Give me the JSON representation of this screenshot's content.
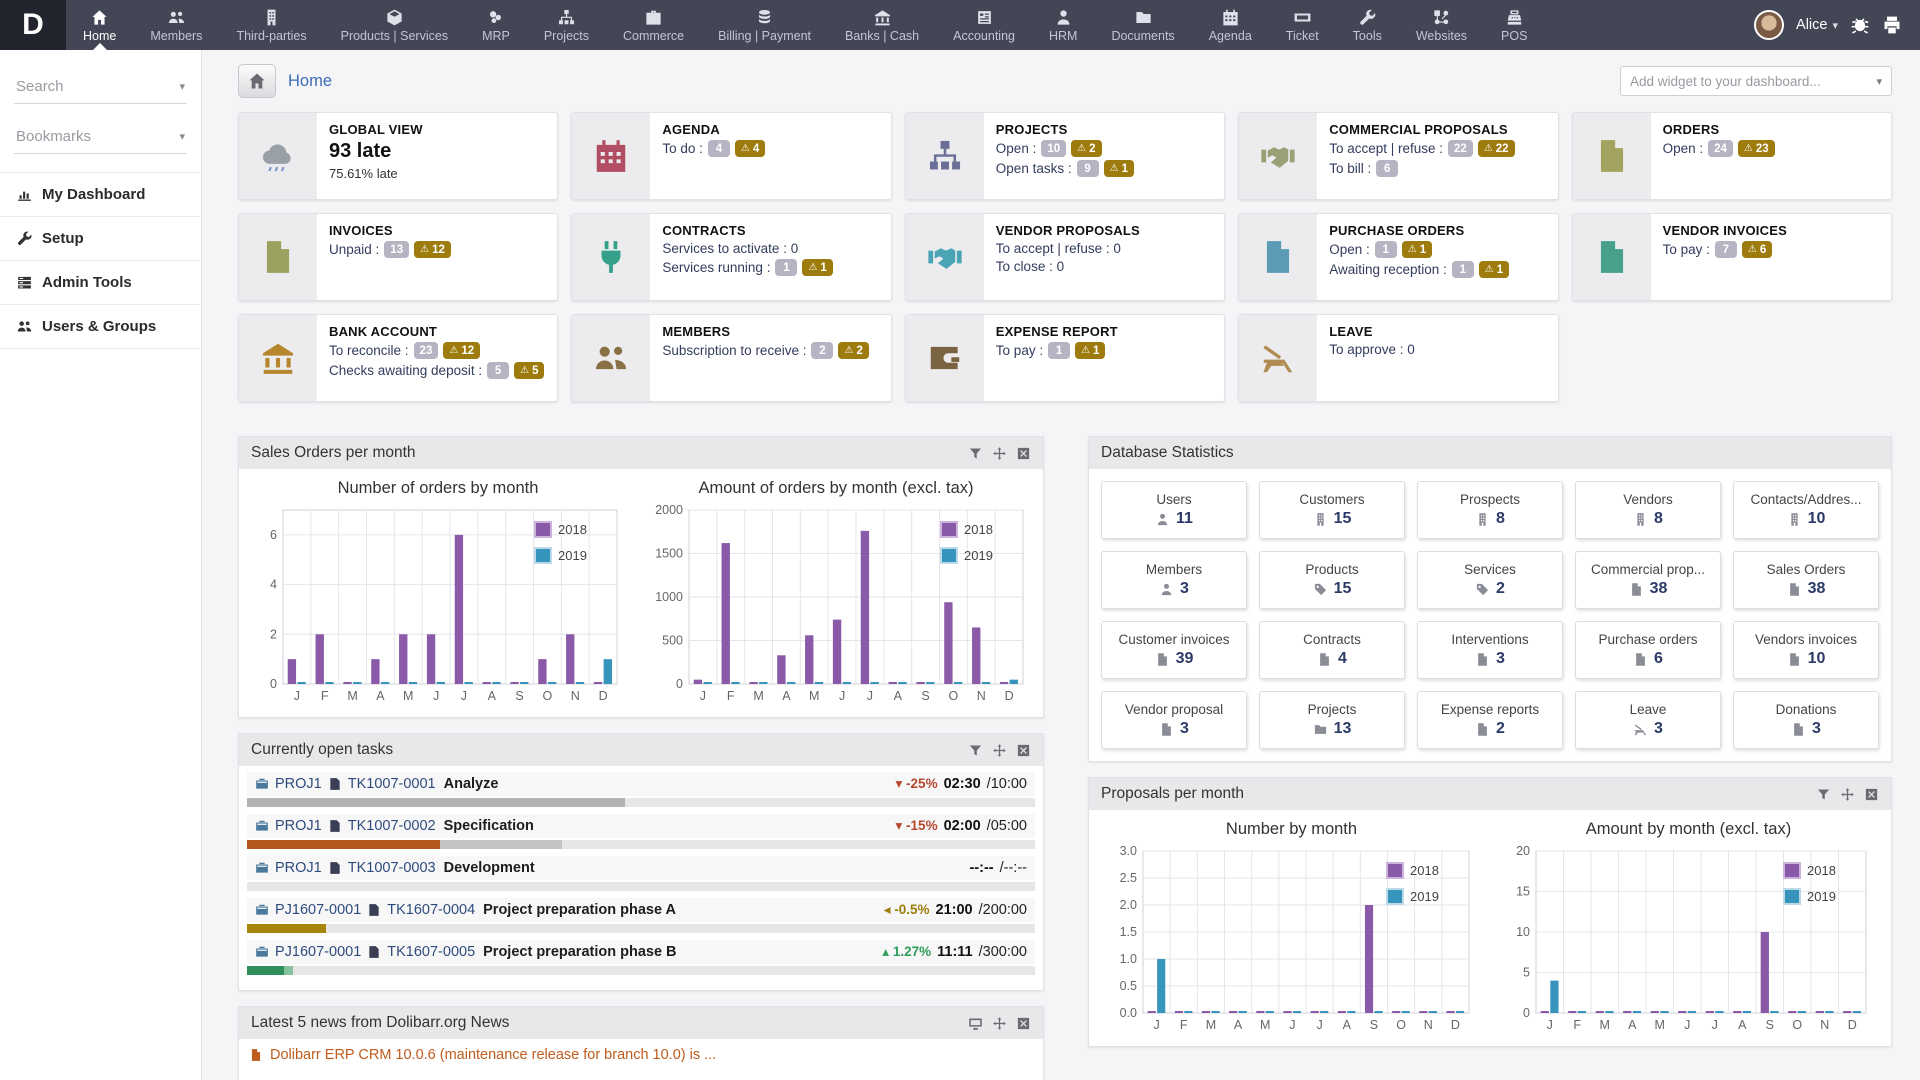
{
  "colors": {
    "navbar_bg": "#424655",
    "logo_bg": "#23252e",
    "accent_link": "#3b6db4",
    "badge_count": "#b7b3c2",
    "badge_warn": "#9d7b0c",
    "bar_2018": "#8a5aa8",
    "bar_2019": "#3795bd"
  },
  "navbar": {
    "logo": "D",
    "items": [
      {
        "label": "Home",
        "icon": "home-icon",
        "active": true
      },
      {
        "label": "Members",
        "icon": "members-icon"
      },
      {
        "label": "Third-parties",
        "icon": "building-icon"
      },
      {
        "label": "Products | Services",
        "icon": "cube-icon"
      },
      {
        "label": "MRP",
        "icon": "mrp-icon"
      },
      {
        "label": "Projects",
        "icon": "sitemap-icon"
      },
      {
        "label": "Commerce",
        "icon": "briefcase-icon"
      },
      {
        "label": "Billing | Payment",
        "icon": "coins-icon"
      },
      {
        "label": "Banks | Cash",
        "icon": "bank-icon"
      },
      {
        "label": "Accounting",
        "icon": "calculator-icon"
      },
      {
        "label": "HRM",
        "icon": "person-icon"
      },
      {
        "label": "Documents",
        "icon": "folder-icon"
      },
      {
        "label": "Agenda",
        "icon": "calendar-icon"
      },
      {
        "label": "Ticket",
        "icon": "ticket-icon"
      },
      {
        "label": "Tools",
        "icon": "wrench-icon"
      },
      {
        "label": "Websites",
        "icon": "nodes-icon"
      },
      {
        "label": "POS",
        "icon": "register-icon"
      }
    ],
    "user": {
      "name": "Alice"
    }
  },
  "sidebar": {
    "search_label": "Search",
    "bookmarks_label": "Bookmarks",
    "items": [
      {
        "label": "My Dashboard",
        "icon": "chartbar-icon"
      },
      {
        "label": "Setup",
        "icon": "wrench-icon"
      },
      {
        "label": "Admin Tools",
        "icon": "server-icon"
      },
      {
        "label": "Users & Groups",
        "icon": "members-icon"
      }
    ]
  },
  "breadcrumb": {
    "title": "Home"
  },
  "add_widget_placeholder": "Add widget to your dashboard...",
  "kpi_boxes": [
    {
      "title": "GLOBAL VIEW",
      "icon": "cloud-icon",
      "color": "#9aa0a8",
      "lines": [
        {
          "text": "93 late",
          "style": "big"
        },
        {
          "text": "75.61% late",
          "style": "small"
        }
      ]
    },
    {
      "title": "AGENDA",
      "icon": "calendar-icon",
      "color": "#b24e63",
      "lines": [
        {
          "text": "To do :",
          "count": "4",
          "warn": "4"
        }
      ]
    },
    {
      "title": "PROJECTS",
      "icon": "sitemap-icon",
      "color": "#6b6e96",
      "lines": [
        {
          "text": "Open :",
          "count": "10",
          "warn": "2"
        },
        {
          "text": "Open tasks :",
          "count": "9",
          "warn": "1"
        }
      ]
    },
    {
      "title": "COMMERCIAL PROPOSALS",
      "icon": "handshake-icon",
      "color": "#9aa076",
      "lines": [
        {
          "text": "To accept | refuse :",
          "count": "22",
          "warn": "22"
        },
        {
          "text": "To bill :",
          "count": "6"
        }
      ]
    },
    {
      "title": "ORDERS",
      "icon": "doc-icon",
      "color": "#a3a35f",
      "lines": [
        {
          "text": "Open :",
          "count": "24",
          "warn": "23"
        }
      ]
    },
    {
      "title": "INVOICES",
      "icon": "doc-icon",
      "color": "#9aa05e",
      "lines": [
        {
          "text": "Unpaid :",
          "count": "13",
          "warn": "12"
        }
      ]
    },
    {
      "title": "CONTRACTS",
      "icon": "plug-icon",
      "color": "#35a08a",
      "lines": [
        {
          "text": "Services to activate : 0"
        },
        {
          "text": "Services running :",
          "count": "1",
          "warn": "1"
        }
      ]
    },
    {
      "title": "VENDOR PROPOSALS",
      "icon": "handshake-icon",
      "color": "#4aa4b5",
      "lines": [
        {
          "text": "To accept | refuse : 0"
        },
        {
          "text": "To close : 0"
        }
      ]
    },
    {
      "title": "PURCHASE ORDERS",
      "icon": "doc-icon",
      "color": "#5b9bb5",
      "lines": [
        {
          "text": "Open :",
          "count": "1",
          "warn": "1"
        },
        {
          "text": "Awaiting reception :",
          "count": "1",
          "warn": "1"
        }
      ]
    },
    {
      "title": "VENDOR INVOICES",
      "icon": "doc-icon",
      "color": "#46a08c",
      "lines": [
        {
          "text": "To pay :",
          "count": "7",
          "warn": "6"
        }
      ]
    },
    {
      "title": "BANK ACCOUNT",
      "icon": "bank-icon",
      "color": "#b5862b",
      "lines": [
        {
          "text": "To reconcile :",
          "count": "23",
          "warn": "12"
        },
        {
          "text": "Checks awaiting deposit :",
          "count": "5",
          "warn": "5"
        }
      ]
    },
    {
      "title": "MEMBERS",
      "icon": "members-icon",
      "color": "#8a7045",
      "lines": [
        {
          "text": "Subscription to receive :",
          "count": "2",
          "warn": "2"
        }
      ]
    },
    {
      "title": "EXPENSE REPORT",
      "icon": "wallet-icon",
      "color": "#7a6340",
      "lines": [
        {
          "text": "To pay :",
          "count": "1",
          "warn": "1"
        }
      ]
    },
    {
      "title": "LEAVE",
      "icon": "chair-icon",
      "color": "#b08c50",
      "lines": [
        {
          "text": "To approve : 0"
        }
      ]
    }
  ],
  "panels": {
    "sales_orders": {
      "title": "Sales Orders per month"
    },
    "tasks": {
      "title": "Currently open tasks",
      "rows": [
        {
          "project": "PROJ1",
          "task": "TK1007-0001",
          "name": "Analyze",
          "arrow": "▾",
          "pct": "-25%",
          "pct_color": "#b5482f",
          "time": "02:30",
          "total": "/10:00",
          "bar": [
            {
              "color": "#b3b3b3",
              "w": 48
            }
          ]
        },
        {
          "project": "PROJ1",
          "task": "TK1007-0002",
          "name": "Specification",
          "arrow": "▾",
          "pct": "-15%",
          "pct_color": "#b5482f",
          "time": "02:00",
          "total": "/05:00",
          "bar": [
            {
              "color": "#b3591d",
              "w": 24.5
            },
            {
              "color": "#c4c4c4",
              "w": 15.5
            }
          ]
        },
        {
          "project": "PROJ1",
          "task": "TK1007-0003",
          "name": "Development",
          "arrow": "",
          "pct": "",
          "pct_color": "#333",
          "time": "--:--",
          "total": "/--:--",
          "bar": []
        },
        {
          "project": "PJ1607-0001",
          "task": "TK1607-0004",
          "name": "Project preparation phase A",
          "arrow": "◂",
          "pct": "-0.5%",
          "pct_color": "#9a7d0a",
          "time": "21:00",
          "total": "/200:00",
          "bar": [
            {
              "color": "#a8860b",
              "w": 10
            }
          ]
        },
        {
          "project": "PJ1607-0001",
          "task": "TK1607-0005",
          "name": "Project preparation phase B",
          "arrow": "▴",
          "pct": "1.27%",
          "pct_color": "#2e9e5b",
          "time": "11:11",
          "total": "/300:00",
          "bar": [
            {
              "color": "#2f8f5b",
              "w": 4.7
            },
            {
              "color": "#84c39e",
              "w": 1.2
            }
          ]
        }
      ]
    },
    "news": {
      "title": "Latest 5 news from Dolibarr.org News",
      "first_item": "Dolibarr ERP CRM 10.0.6 (maintenance release for branch 10.0) is ..."
    },
    "db_stats": {
      "title": "Database Statistics",
      "cells": [
        {
          "label": "Users",
          "value": "11",
          "icon": "person-icon"
        },
        {
          "label": "Customers",
          "value": "15",
          "icon": "building-icon"
        },
        {
          "label": "Prospects",
          "value": "8",
          "icon": "building-icon"
        },
        {
          "label": "Vendors",
          "value": "8",
          "icon": "building-icon"
        },
        {
          "label": "Contacts/Addres...",
          "value": "10",
          "icon": "building-icon"
        },
        {
          "label": "Members",
          "value": "3",
          "icon": "person-icon"
        },
        {
          "label": "Products",
          "value": "15",
          "icon": "tag-icon"
        },
        {
          "label": "Services",
          "value": "2",
          "icon": "tag-icon"
        },
        {
          "label": "Commercial prop...",
          "value": "38",
          "icon": "doc-icon"
        },
        {
          "label": "Sales Orders",
          "value": "38",
          "icon": "doc-icon"
        },
        {
          "label": "Customer invoices",
          "value": "39",
          "icon": "doc-icon"
        },
        {
          "label": "Contracts",
          "value": "4",
          "icon": "doc-icon"
        },
        {
          "label": "Interventions",
          "value": "3",
          "icon": "doc-icon"
        },
        {
          "label": "Purchase orders",
          "value": "6",
          "icon": "doc-icon"
        },
        {
          "label": "Vendors invoices",
          "value": "10",
          "icon": "doc-icon"
        },
        {
          "label": "Vendor proposal",
          "value": "3",
          "icon": "doc-icon"
        },
        {
          "label": "Projects",
          "value": "13",
          "icon": "folder-icon"
        },
        {
          "label": "Expense reports",
          "value": "2",
          "icon": "doc-icon"
        },
        {
          "label": "Leave",
          "value": "3",
          "icon": "chair-icon"
        },
        {
          "label": "Donations",
          "value": "3",
          "icon": "doc-icon"
        }
      ]
    },
    "proposals": {
      "title": "Proposals per month"
    }
  },
  "chart_data": [
    {
      "type": "bar",
      "title": "Number of orders by month",
      "categories": [
        "J",
        "F",
        "M",
        "A",
        "M",
        "J",
        "J",
        "A",
        "S",
        "O",
        "N",
        "D"
      ],
      "series": [
        {
          "name": "2018",
          "color": "#8a5aa8",
          "values": [
            1,
            2,
            0,
            1,
            2,
            2,
            6,
            0,
            0,
            1,
            2,
            0
          ]
        },
        {
          "name": "2019",
          "color": "#3795bd",
          "values": [
            0,
            0,
            0,
            0,
            0,
            0,
            0,
            0,
            0,
            0,
            0,
            1
          ]
        }
      ],
      "ylim": [
        0,
        7
      ],
      "tick_values": [
        0,
        2,
        4,
        6
      ],
      "tick_labels": [
        "0",
        "2",
        "4",
        "6"
      ],
      "grid": true,
      "legend_position": "top-right"
    },
    {
      "type": "bar",
      "title": "Amount of orders by month (excl. tax)",
      "categories": [
        "J",
        "F",
        "M",
        "A",
        "M",
        "J",
        "J",
        "A",
        "S",
        "O",
        "N",
        "D"
      ],
      "series": [
        {
          "name": "2018",
          "color": "#8a5aa8",
          "values": [
            50,
            1620,
            0,
            330,
            560,
            740,
            1760,
            0,
            0,
            940,
            650,
            20
          ]
        },
        {
          "name": "2019",
          "color": "#3795bd",
          "values": [
            0,
            0,
            0,
            0,
            0,
            0,
            0,
            0,
            0,
            0,
            0,
            50
          ]
        }
      ],
      "ylim": [
        0,
        2000
      ],
      "tick_values": [
        0,
        500,
        1000,
        1500,
        2000
      ],
      "tick_labels": [
        "0",
        "500",
        "1000",
        "1500",
        "2000"
      ],
      "grid": true,
      "legend_position": "top-right"
    },
    {
      "type": "bar",
      "title": "Number by month",
      "categories": [
        "J",
        "F",
        "M",
        "A",
        "M",
        "J",
        "J",
        "A",
        "S",
        "O",
        "N",
        "D"
      ],
      "series": [
        {
          "name": "2018",
          "color": "#8a5aa8",
          "values": [
            0,
            0,
            0,
            0,
            0,
            0,
            0,
            0,
            2,
            0,
            0,
            0
          ]
        },
        {
          "name": "2019",
          "color": "#3795bd",
          "values": [
            1,
            0,
            0,
            0,
            0,
            0,
            0,
            0,
            0,
            0,
            0,
            0
          ]
        }
      ],
      "ylim": [
        0,
        3
      ],
      "tick_values": [
        0,
        0.5,
        1,
        1.5,
        2,
        2.5,
        3
      ],
      "tick_labels": [
        "0.0",
        "0.5",
        "1.0",
        "1.5",
        "2.0",
        "2.5",
        "3.0"
      ],
      "grid": true,
      "legend_position": "top-right"
    },
    {
      "type": "bar",
      "title": "Amount by month (excl. tax)",
      "categories": [
        "J",
        "F",
        "M",
        "A",
        "M",
        "J",
        "J",
        "A",
        "S",
        "O",
        "N",
        "D"
      ],
      "series": [
        {
          "name": "2018",
          "color": "#8a5aa8",
          "values": [
            0,
            0,
            0,
            0,
            0,
            0,
            0,
            0,
            10,
            0,
            0,
            0
          ]
        },
        {
          "name": "2019",
          "color": "#3795bd",
          "values": [
            4,
            0,
            0,
            0,
            0,
            0,
            0,
            0,
            0,
            0,
            0,
            0
          ]
        }
      ],
      "ylim": [
        0,
        20
      ],
      "tick_values": [
        0,
        5,
        10,
        15,
        20
      ],
      "tick_labels": [
        "0",
        "5",
        "10",
        "15",
        "20"
      ],
      "grid": true,
      "legend_position": "top-right"
    }
  ]
}
